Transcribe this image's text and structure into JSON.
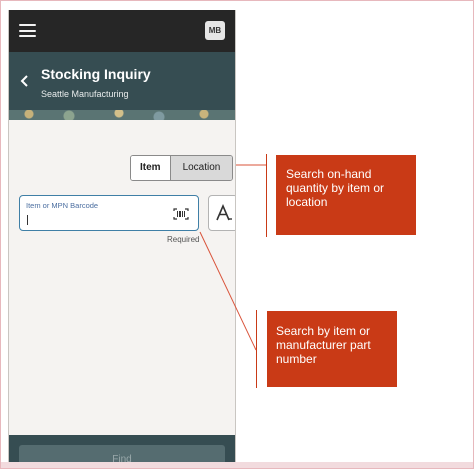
{
  "top_bar": {
    "avatar_initials": "MB",
    "menu_icon": "hamburger-menu-icon"
  },
  "header": {
    "title": "Stocking Inquiry",
    "subtitle": "Seattle Manufacturing",
    "back_icon": "chevron-left-icon"
  },
  "search_toggle": {
    "options": [
      "Item",
      "Location"
    ],
    "selected": "Item"
  },
  "search_field": {
    "label": "Item or MPN Barcode",
    "value": "",
    "required_text": "Required",
    "icon": "barcode-scan-icon"
  },
  "font_button_icon": "text-size-icon",
  "footer": {
    "find_label": "Find"
  },
  "callouts": [
    {
      "text": "Search on-hand quantity by item or location"
    },
    {
      "text": "Search by item or manufacturer part number"
    }
  ],
  "colors": {
    "top_bar": "#262626",
    "header": "#364d52",
    "callout": "#c93a16",
    "input_border": "#3f7fa6"
  }
}
